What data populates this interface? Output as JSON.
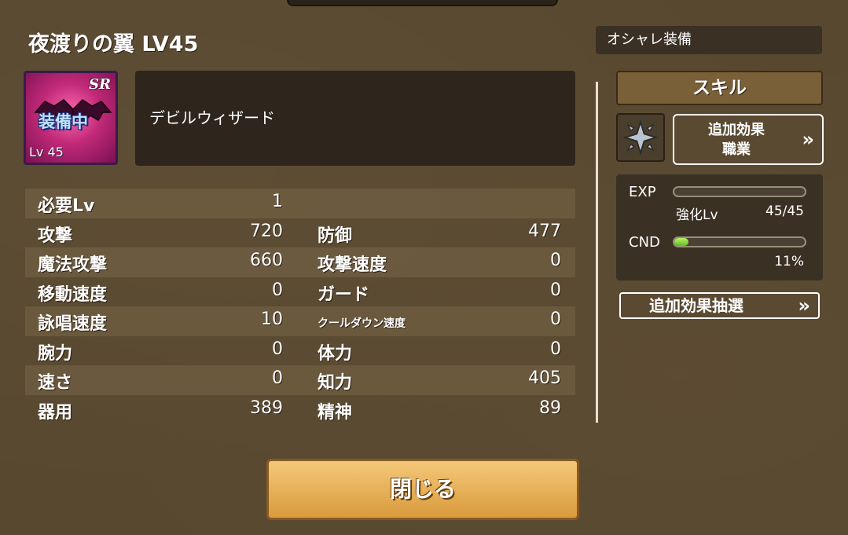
{
  "item": {
    "title": "夜渡りの翼 LV45",
    "rarity": "SR",
    "equipped_label": "装備中",
    "level_label": "Lv 45",
    "description": "デビルウィザード"
  },
  "header": {
    "fashion_tab": "オシャレ装備"
  },
  "stats": {
    "rows": [
      {
        "left_label": "必要Lv",
        "left_value": "1",
        "right_label": "",
        "right_value": ""
      },
      {
        "left_label": "攻撃",
        "left_value": "720",
        "right_label": "防御",
        "right_value": "477"
      },
      {
        "left_label": "魔法攻撃",
        "left_value": "660",
        "right_label": "攻撃速度",
        "right_value": "0"
      },
      {
        "left_label": "移動速度",
        "left_value": "0",
        "right_label": "ガード",
        "right_value": "0"
      },
      {
        "left_label": "詠唱速度",
        "left_value": "10",
        "right_label": "クールダウン速度",
        "right_value": "0"
      },
      {
        "left_label": "腕力",
        "left_value": "0",
        "right_label": "体力",
        "right_value": "0"
      },
      {
        "left_label": "速さ",
        "left_value": "0",
        "right_label": "知力",
        "right_value": "405"
      },
      {
        "left_label": "器用",
        "left_value": "389",
        "right_label": "精神",
        "right_value": "89"
      }
    ]
  },
  "side": {
    "skill_button": "スキル",
    "skill_icon": "compass-star-icon",
    "bonus_button_line1": "追加効果",
    "bonus_button_line2": "職業",
    "exp_label": "EXP",
    "exp_fill": 0.0,
    "enhance_label": "強化Lv",
    "enhance_value": "45/45",
    "cnd_label": "CND",
    "cnd_fill": 0.11,
    "cnd_value": "11%",
    "lottery_button": "追加効果抽選"
  },
  "footer": {
    "close_button": "閉じる"
  },
  "colors": {
    "panel": "#584830",
    "button_gold": "#e6b060",
    "bar_green": "#7bd63a",
    "item_pink": "#c22a78"
  }
}
